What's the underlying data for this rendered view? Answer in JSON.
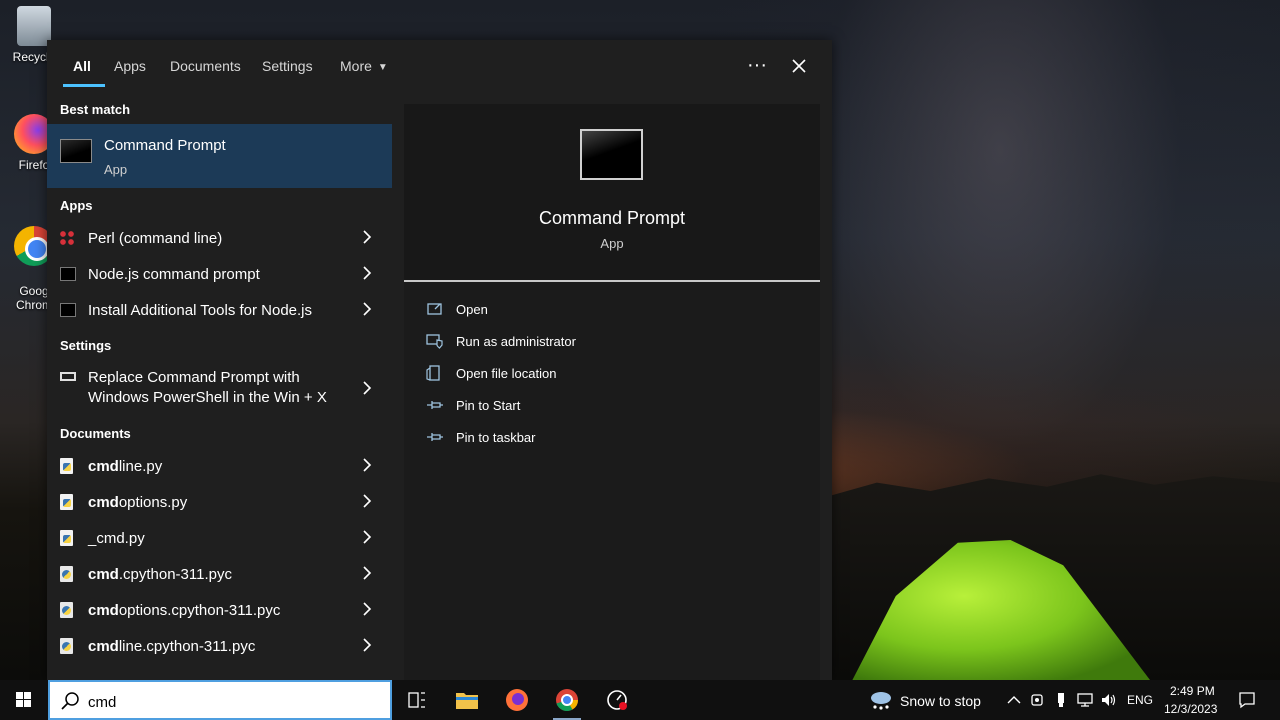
{
  "desktop": {
    "icons": [
      {
        "label": "Recycle",
        "icon": "recycle-bin-icon"
      },
      {
        "label": "Firefo",
        "icon": "firefox-icon"
      },
      {
        "label": "Goog\nChrom",
        "icon": "chrome-icon"
      }
    ]
  },
  "search_panel": {
    "tabs": [
      {
        "label": "All",
        "active": true
      },
      {
        "label": "Apps",
        "active": false
      },
      {
        "label": "Documents",
        "active": false
      },
      {
        "label": "Settings",
        "active": false
      },
      {
        "label": "More",
        "active": false
      }
    ],
    "more_options_label": "···",
    "close_label": "✕",
    "best_match": {
      "section_label": "Best match",
      "title": "Command Prompt",
      "subtitle": "App",
      "icon": "command-prompt-icon"
    },
    "apps": {
      "section_label": "Apps",
      "items": [
        {
          "label": "Perl (command line)",
          "icon": "perl-icon"
        },
        {
          "label": "Node.js command prompt",
          "icon": "command-prompt-icon"
        },
        {
          "label": "Install Additional Tools for Node.js",
          "icon": "command-prompt-icon"
        }
      ]
    },
    "settings": {
      "section_label": "Settings",
      "items": [
        {
          "line1": "Replace Command Prompt with",
          "line2": "Windows PowerShell in the Win + X",
          "icon": "monitor-icon"
        }
      ]
    },
    "documents": {
      "section_label": "Documents",
      "items": [
        {
          "bold": "cmd",
          "rest": "line.py",
          "icon": "python-file-icon"
        },
        {
          "bold": "cmd",
          "rest": "options.py",
          "icon": "python-file-icon"
        },
        {
          "bold": "",
          "rest": "_cmd.py",
          "icon": "python-file-icon"
        },
        {
          "bold": "cmd",
          "rest": ".cpython-311.pyc",
          "icon": "python-compiled-icon"
        },
        {
          "bold": "cmd",
          "rest": "options.cpython-311.pyc",
          "icon": "python-compiled-icon"
        },
        {
          "bold": "cmd",
          "rest": "line.cpython-311.pyc",
          "icon": "python-compiled-icon"
        }
      ]
    },
    "preview": {
      "title": "Command Prompt",
      "subtitle": "App",
      "actions": [
        {
          "label": "Open",
          "icon": "open-window-icon"
        },
        {
          "label": "Run as administrator",
          "icon": "shield-icon"
        },
        {
          "label": "Open file location",
          "icon": "file-location-icon"
        },
        {
          "label": "Pin to Start",
          "icon": "pin-icon"
        },
        {
          "label": "Pin to taskbar",
          "icon": "pin-icon"
        }
      ]
    }
  },
  "taskbar": {
    "search_value": "cmd",
    "weather_text": "Snow to stop",
    "language": "ENG",
    "time": "2:49 PM",
    "date": "12/3/2023",
    "accent_color": "#4cc2ff"
  }
}
